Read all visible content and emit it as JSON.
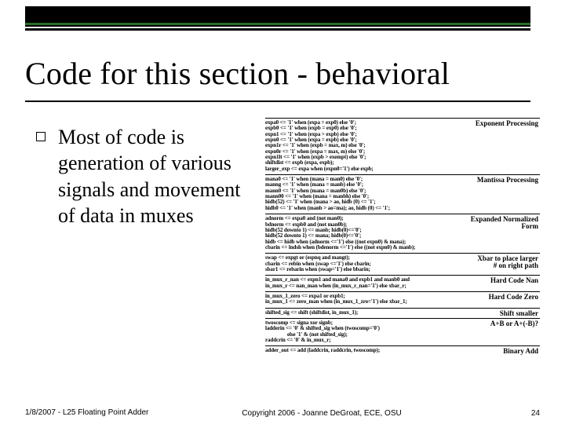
{
  "title": "Code for this section - behavioral",
  "bullet": "Most of code is generation of various signals and movement of data in muxes",
  "sections": [
    {
      "label": "Exponent Processing",
      "lines": [
        "expa0 <= '1' when (expa = exp0) else '0';",
        "expb0 <= '1' when (expb = exp0) else '0';",
        "expn1 <= '1' when (expa > expb) else '0';",
        "expn0 <= '1' when (expa = expb) else '0';",
        "expn1r <= '1' when (expb = max, m) else '0';",
        "expn0r <= '1' when (expa = max, m) else '0';",
        "expn1lt <= '1' when (expb > exempt) else '0';",
        "shiftdist <= expb (expa, expb);",
        "larger_exp <= expa when (expn0='1') else expb;"
      ]
    },
    {
      "label": "Mantissa Processing",
      "lines": [
        "mana0 <= '1' when (mana = man0) else '0';",
        "manng <= '1' when (mana = manb) else '0';",
        "mann0 <= '1' when (mana = man0b) else '0';",
        "mann00 <= '1' when (mana = manbh) else '0';",
        "hidb(52) <= '1' when (mana > ao, hidb (0) <= '1';",
        "hidb0 <= '1' when (manb > ao=ma); ao, hidb (0) <= '1';"
      ]
    },
    {
      "label": "Expanded Normalized\nForm",
      "lines": [
        "adnorm <= expa0 and (not man0);",
        "bdnorm <= expb0 and (not man0b);",
        "hidb(52 downto 1) <= manb; hidb(0)<='0';",
        "hidb(52 downto 1) <= mana; hidb(0)<='0';",
        "hidb <= hidb when (adnorm <='1') else ((not expn0) & mana);",
        "cbarin <= lndsh when (bdenorm <='1') else ((not expn0) & manb);"
      ]
    },
    {
      "label": "Xbar to place larger\n# on right path",
      "lines": [
        "swap <= expgt or (espnq and mangt);",
        "cbarin <= rebin when (swap <='1') else cbarin;",
        "sbar1 <= rebarin when (swap='1') else bbarin;"
      ]
    },
    {
      "label": "Hard Code Nan",
      "lines": [
        "in_mux_r_nan <= expn1 and mana0 and expb1 and manb0 and",
        "in_mux_r <= nan_man when (in_mux_r_nan='1') else xbar_r;"
      ]
    },
    {
      "label": "Hard Code Zero",
      "lines": [
        "in_mux_1_zero <= expa1 or expb1;",
        "in_mux_1 <= zero_man when (in_mux_1_zro='1') else xbar_1;"
      ]
    },
    {
      "label": "Shift smaller",
      "lines": [
        "shifted_sig <= shift (shiftdist, in_mux_1);"
      ]
    },
    {
      "label": "A+B or A+(-B)?",
      "lines": [
        "twoscomp <= signa xor signb;",
        "ladderin <= '0' & shifted_sig when (twoscomp='0')",
        "                 else '1' & (not shifted_sig);",
        "raddcrin <= '0' & in_mux_r;"
      ]
    },
    {
      "label": "Binary Add",
      "lines": [
        "adder_out <= add (laddcrin, raddcrin, twoscomp);"
      ]
    }
  ],
  "footer": {
    "left": "1/8/2007 - L25 Floating Point Adder",
    "center": "Copyright 2006 - Joanne DeGroat, ECE, OSU",
    "right": "24"
  }
}
